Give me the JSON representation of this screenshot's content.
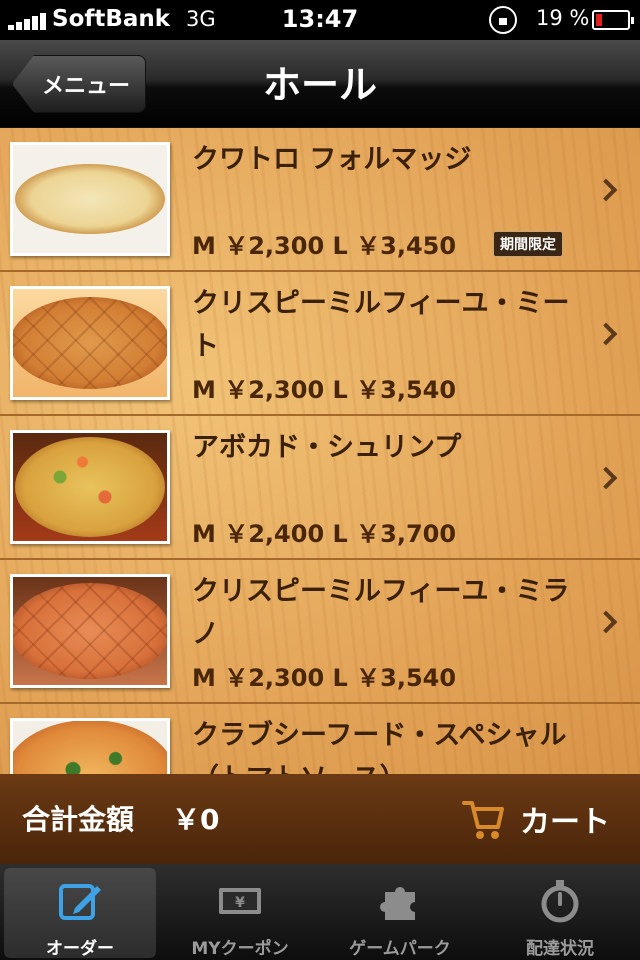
{
  "status": {
    "carrier": "SoftBank",
    "network": "3G",
    "time": "13:47",
    "battery": "19 %",
    "battery_level": 0.19
  },
  "nav": {
    "back_label": "メニュー",
    "title": "ホール"
  },
  "items": [
    {
      "name": "クワトロ フォルマッジ",
      "price": "M ￥2,300 L ￥3,450",
      "badge": "期間限定",
      "thumb_icon": "pizza-quattro-formaggi-image"
    },
    {
      "name": "クリスピーミルフィーユ・ミート",
      "price": "M ￥2,300 L ￥3,540",
      "badge": "",
      "thumb_icon": "pizza-crispy-meat-image"
    },
    {
      "name": "アボカド・シュリンプ",
      "price": "M ￥2,400 L ￥3,700",
      "badge": "",
      "thumb_icon": "pizza-avocado-shrimp-image"
    },
    {
      "name": "クリスピーミルフィーユ・ミラノ",
      "price": "M ￥2,300 L ￥3,540",
      "badge": "",
      "thumb_icon": "pizza-crispy-milano-image"
    },
    {
      "name": "クラブシーフード・スペシャル（トマトソース）",
      "price": "",
      "badge": "",
      "thumb_icon": "pizza-crab-seafood-image"
    }
  ],
  "footer": {
    "total_label": "合計金額",
    "total_value": "￥0",
    "cart_label": "カート"
  },
  "tabs": [
    {
      "label": "オーダー",
      "icon": "pencil-edit-icon",
      "active": true
    },
    {
      "label": "MYクーポン",
      "icon": "coupon-ticket-icon",
      "active": false
    },
    {
      "label": "ゲームパーク",
      "icon": "puzzle-piece-icon",
      "active": false
    },
    {
      "label": "配達状況",
      "icon": "stopwatch-icon",
      "active": false
    }
  ],
  "colors": {
    "wood_bg": "#e3a458",
    "text_brown": "#3b200a",
    "footer_brown": "#5a2e0f",
    "cart_accent": "#d88a2a",
    "tab_active_icon": "#3ea2e6"
  }
}
